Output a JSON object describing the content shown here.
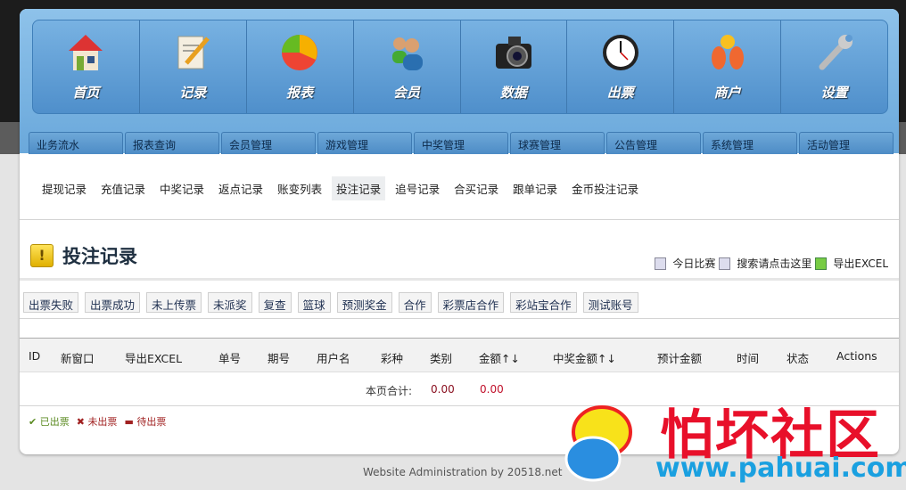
{
  "nav": [
    {
      "label": "首页",
      "icon": "home-icon"
    },
    {
      "label": "记录",
      "icon": "notepad-icon"
    },
    {
      "label": "报表",
      "icon": "pie-chart-icon"
    },
    {
      "label": "会员",
      "icon": "users-icon"
    },
    {
      "label": "数据",
      "icon": "camera-icon"
    },
    {
      "label": "出票",
      "icon": "clock-icon"
    },
    {
      "label": "商户",
      "icon": "merchant-icon"
    },
    {
      "label": "设置",
      "icon": "wrench-icon"
    }
  ],
  "tabs": [
    "业务流水",
    "报表查询",
    "会员管理",
    "游戏管理",
    "中奖管理",
    "球赛管理",
    "公告管理",
    "系统管理",
    "活动管理"
  ],
  "subnav": [
    "提现记录",
    "充值记录",
    "中奖记录",
    "返点记录",
    "账变列表",
    "投注记录",
    "追号记录",
    "合买记录",
    "跟单记录",
    "金币投注记录"
  ],
  "page_title": "投注记录",
  "tools": {
    "today": "今日比赛",
    "search": "搜索请点击这里",
    "export": "导出EXCEL"
  },
  "filters": [
    "出票失败",
    "出票成功",
    "未上传票",
    "未派奖",
    "复查",
    "篮球",
    "预测奖金",
    "合作",
    "彩票店合作",
    "彩站宝合作",
    "测试账号"
  ],
  "columns": [
    "ID",
    "新窗口",
    "导出EXCEL",
    "单号",
    "期号",
    "用户名",
    "彩种",
    "类别",
    "金额↑↓",
    "中奖金额↑↓",
    "预计金额",
    "时间",
    "状态",
    "Actions"
  ],
  "totals": {
    "label": "本页合计:",
    "amount": "0.00",
    "win": "0.00"
  },
  "legend": {
    "issued": "已出票",
    "not_issued": "未出票",
    "pending": "待出票"
  },
  "footer": "Website Administration by 20518.net",
  "watermark": {
    "text": "怕坏社区",
    "url": "www.pahuai.com"
  }
}
